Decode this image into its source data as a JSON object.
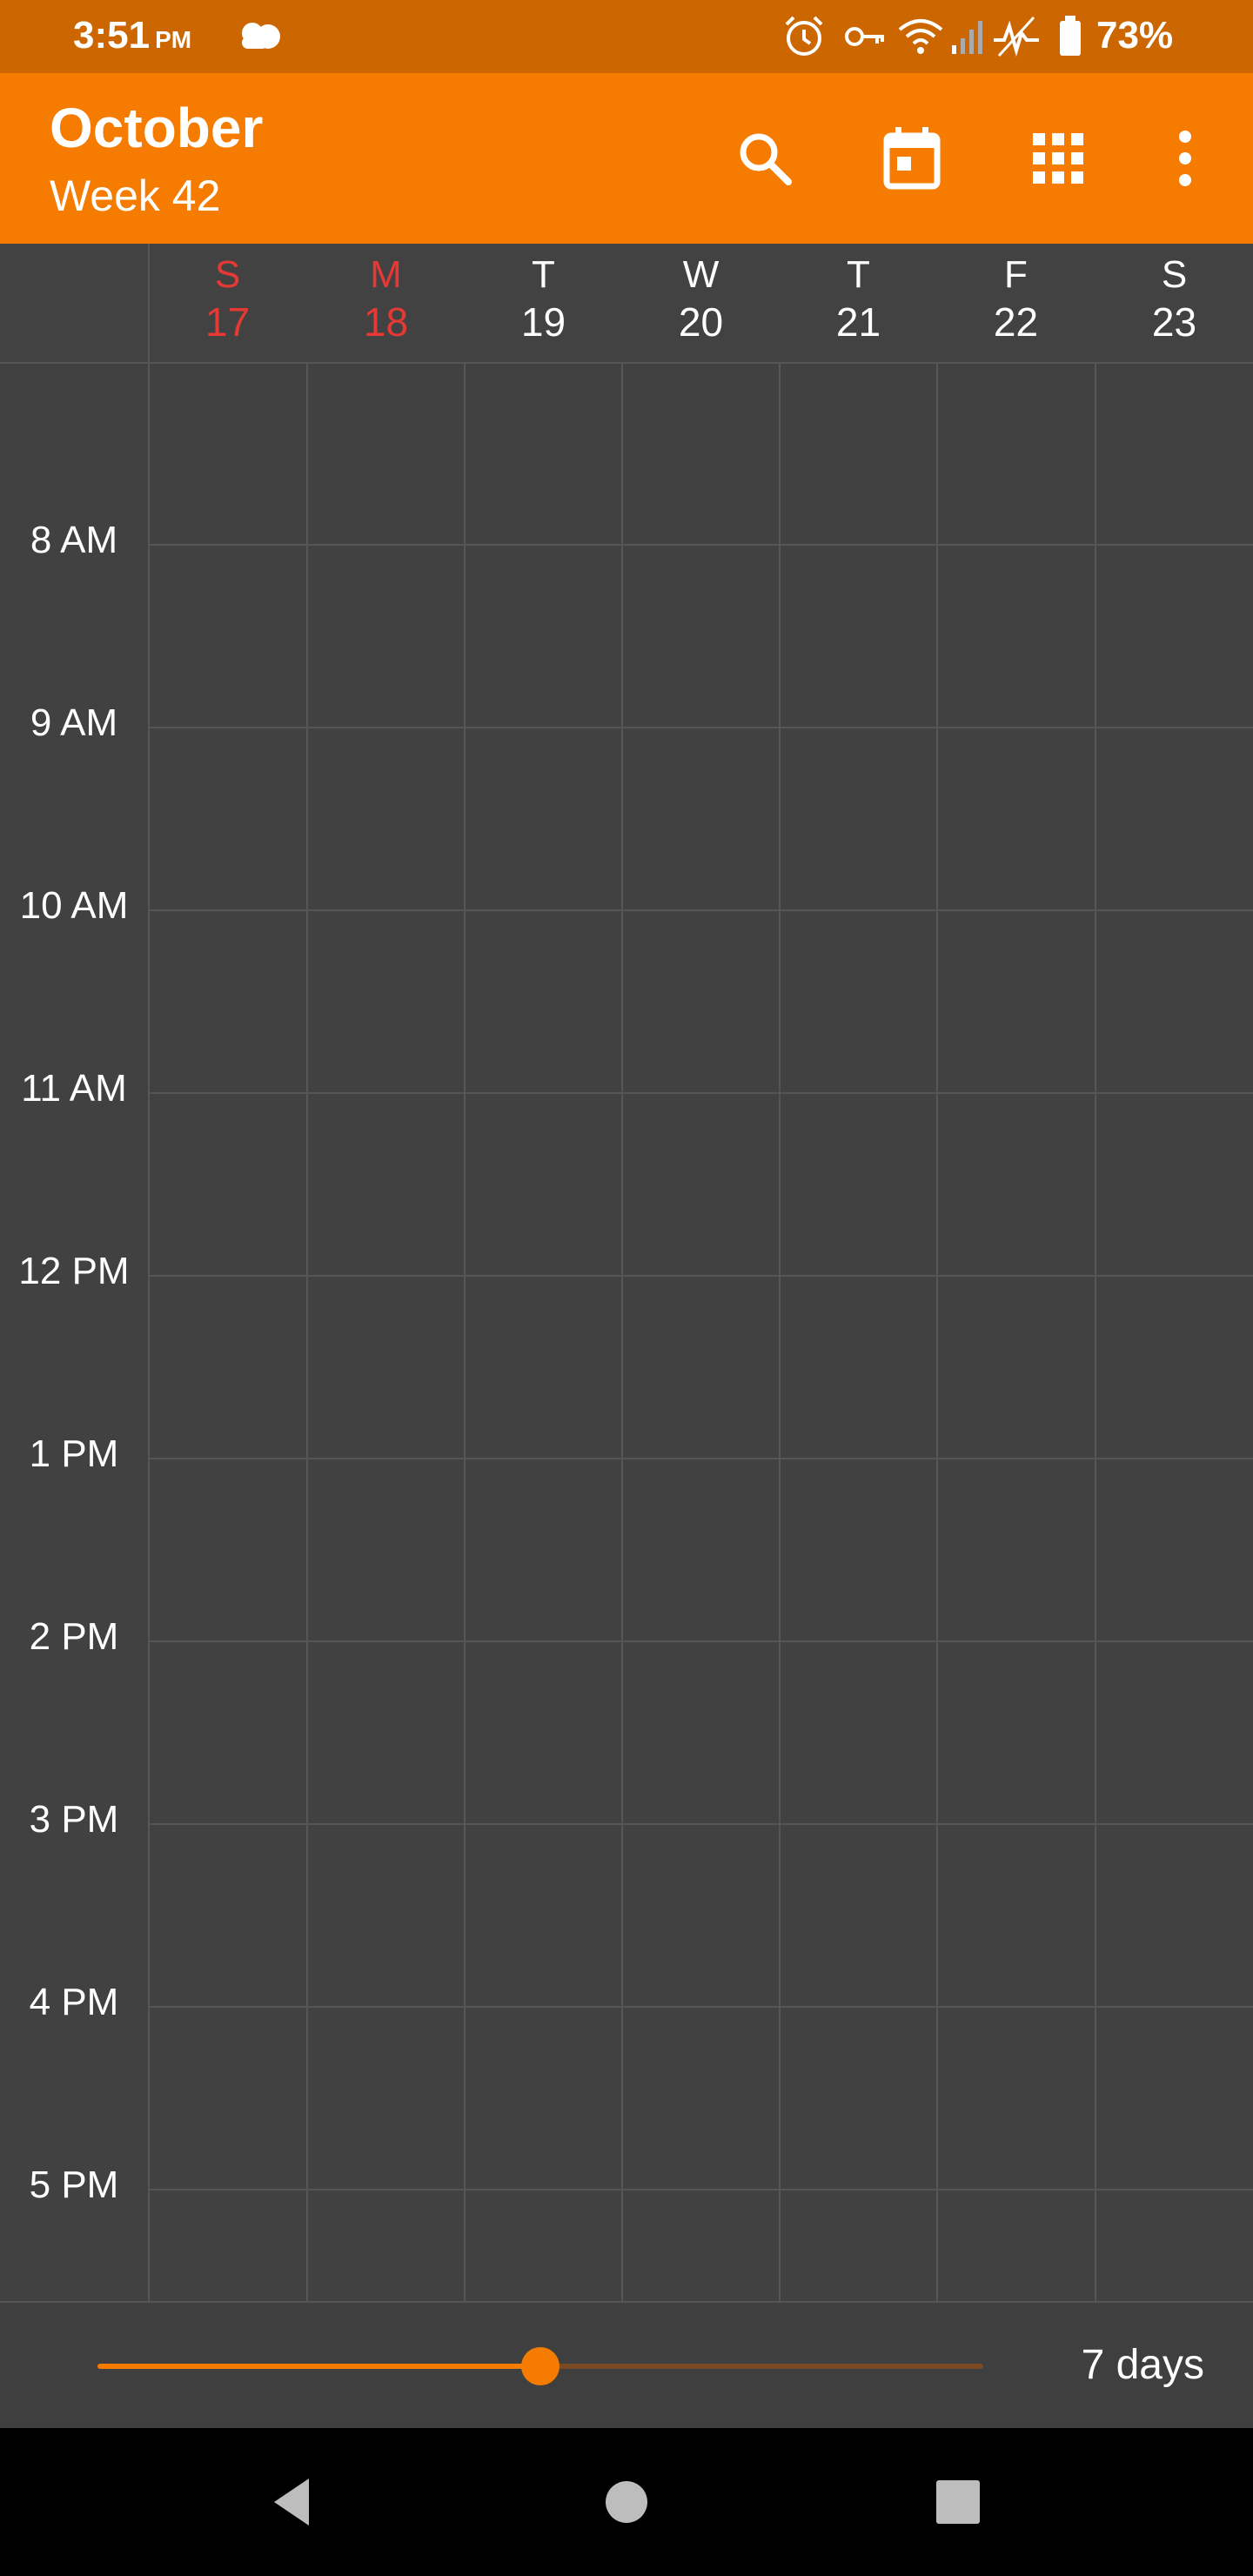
{
  "status_bar": {
    "time": "3:51",
    "ampm": "PM",
    "battery": "73%",
    "icons": [
      "cloud-icon",
      "alarm-icon",
      "vpn-key-icon",
      "wifi-icon",
      "signal-icon",
      "activity-icon",
      "battery-icon"
    ]
  },
  "app_bar": {
    "month": "October",
    "week": "Week 42",
    "actions": [
      "search-icon",
      "calendar-today-icon",
      "grid-view-icon",
      "more-vert-icon"
    ]
  },
  "days": [
    {
      "name": "S",
      "num": "17",
      "highlight": true
    },
    {
      "name": "M",
      "num": "18",
      "highlight": true
    },
    {
      "name": "T",
      "num": "19",
      "highlight": false
    },
    {
      "name": "W",
      "num": "20",
      "highlight": false
    },
    {
      "name": "T",
      "num": "21",
      "highlight": false
    },
    {
      "name": "F",
      "num": "22",
      "highlight": false
    },
    {
      "name": "S",
      "num": "23",
      "highlight": false
    }
  ],
  "hours": [
    "8 AM",
    "9 AM",
    "10 AM",
    "11 AM",
    "12 PM",
    "1 PM",
    "2 PM",
    "3 PM",
    "4 PM",
    "5 PM"
  ],
  "bottom": {
    "slider_value_fraction": 0.5,
    "days_label": "7 days"
  },
  "colors": {
    "accent": "#F57C00",
    "status_bar": "#CC6600",
    "weekend": "#E53935",
    "background": "#414141"
  },
  "nav": [
    "back-icon",
    "home-icon",
    "recents-icon"
  ]
}
